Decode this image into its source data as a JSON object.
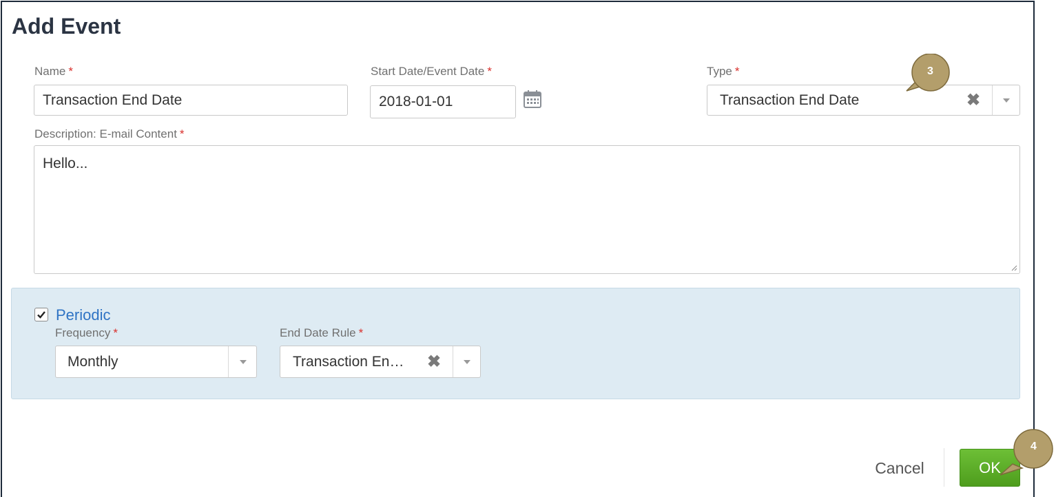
{
  "dialog": {
    "title": "Add Event"
  },
  "fields": {
    "name": {
      "label": "Name",
      "required": "*",
      "value": "Transaction End Date"
    },
    "start_date": {
      "label": "Start Date/Event Date",
      "required": "*",
      "value": "2018-01-01",
      "icon": "calendar-icon"
    },
    "type": {
      "label": "Type",
      "required": "*",
      "value": "Transaction End Date",
      "clear_glyph": "✖"
    },
    "description": {
      "label": "Description: E-mail Content",
      "required": "*",
      "value": "Hello..."
    }
  },
  "periodic": {
    "label": "Periodic",
    "checked": true,
    "frequency": {
      "label": "Frequency",
      "required": "*",
      "value": "Monthly"
    },
    "end_date_rule": {
      "label": "End Date Rule",
      "required": "*",
      "value": "Transaction En…",
      "clear_glyph": "✖"
    }
  },
  "footer": {
    "cancel_label": "Cancel",
    "ok_label": "OK"
  },
  "annotations": {
    "callout_3": "3",
    "callout_4": "4"
  },
  "colors": {
    "required": "#d9302c",
    "periodic_panel": "#deebf3",
    "periodic_link": "#2e73c4",
    "ok_button": "#5cad28",
    "callout_fill": "#b39e6b"
  }
}
